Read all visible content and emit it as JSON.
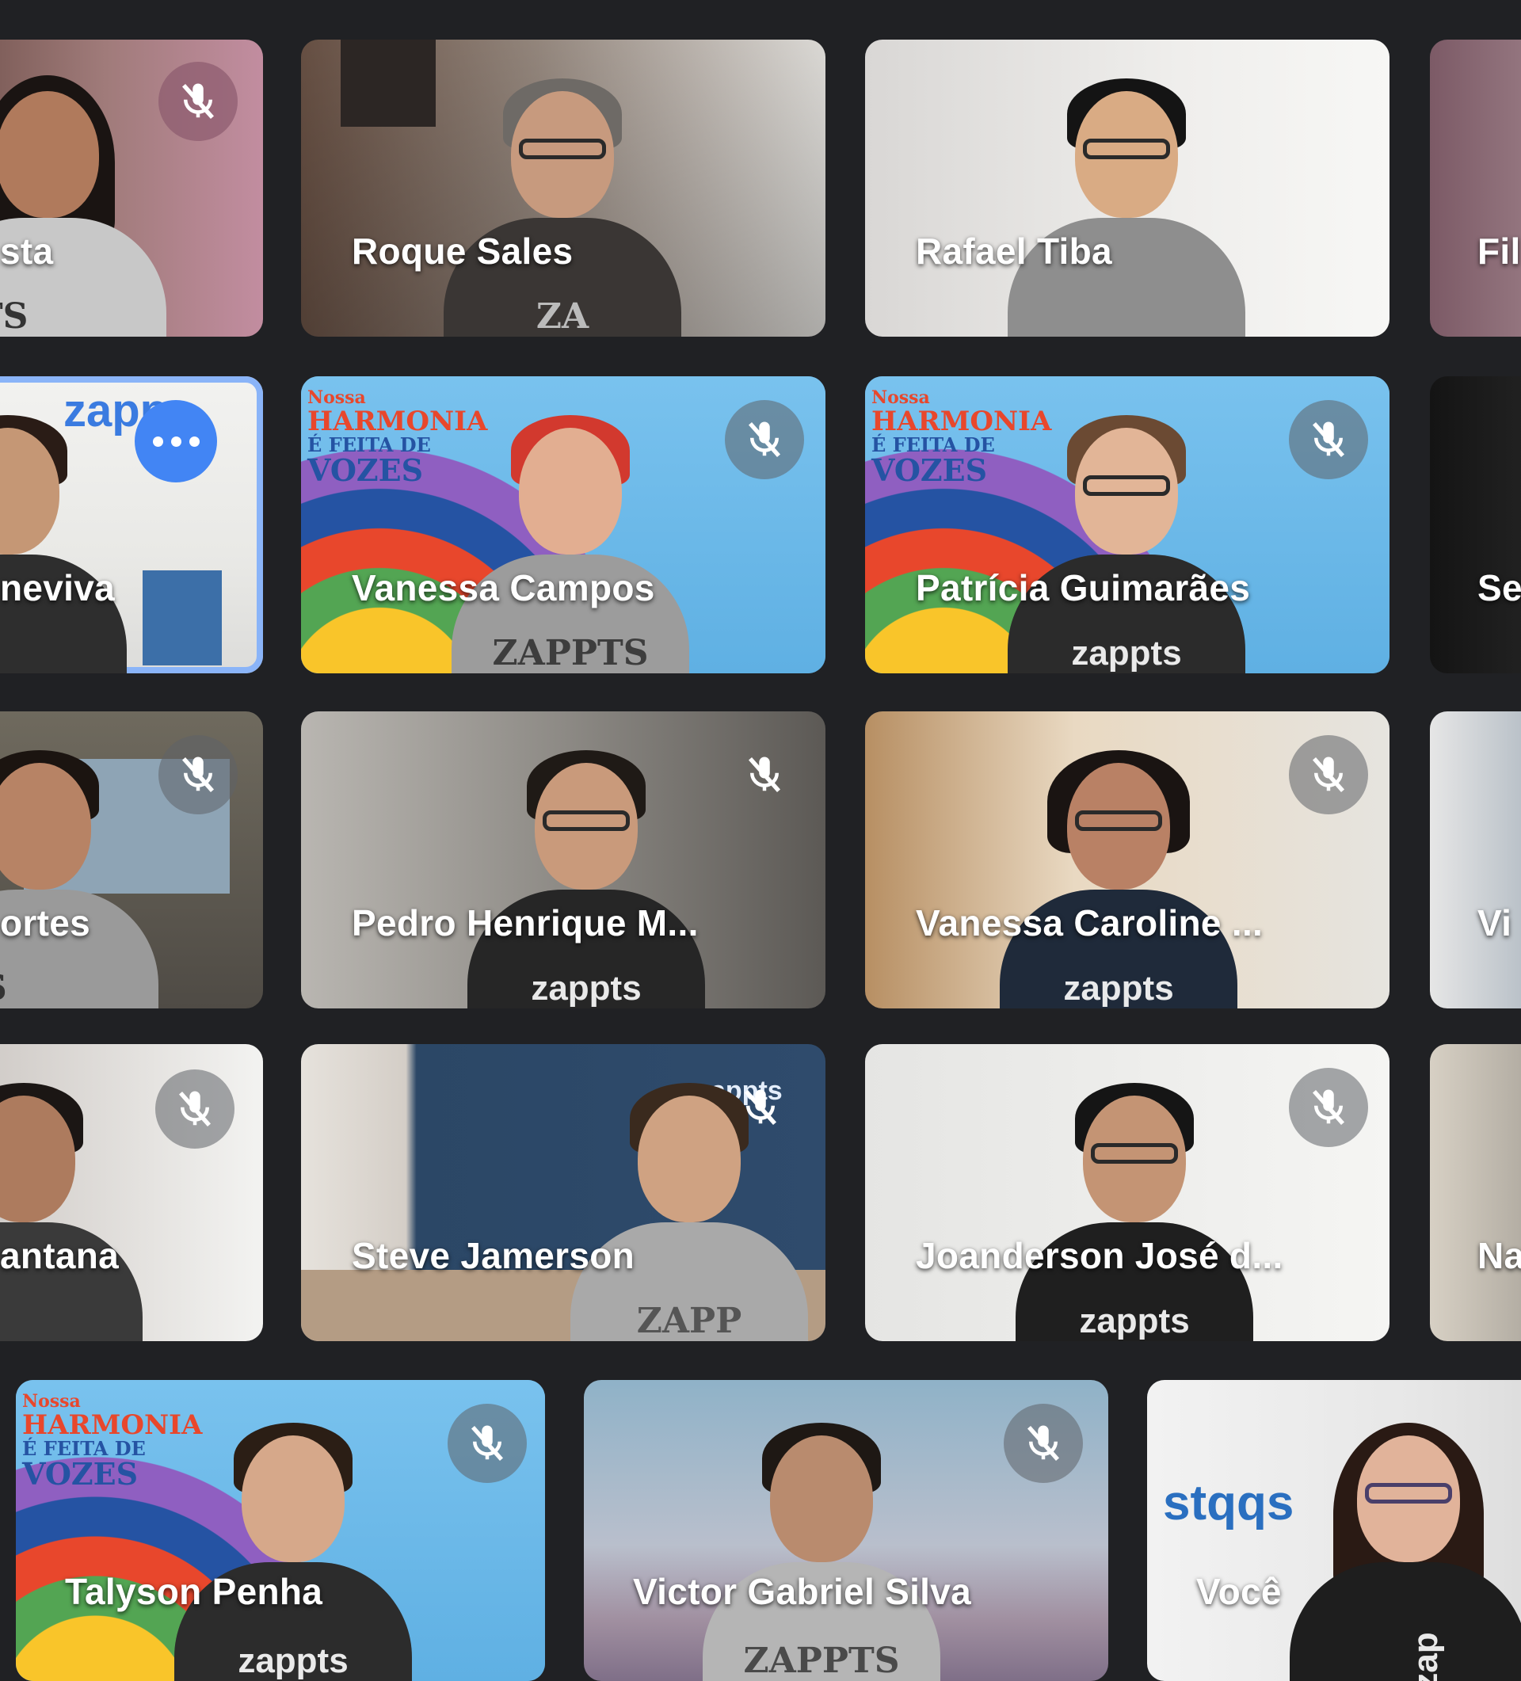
{
  "participants": [
    {
      "name": "sta",
      "muted": true,
      "state": "partial"
    },
    {
      "name": "Roque Sales",
      "muted": false
    },
    {
      "name": "Rafael Tiba",
      "muted": false
    },
    {
      "name": "Fil",
      "muted": false,
      "state": "partial"
    },
    {
      "name": "neviva",
      "muted": false,
      "active": true,
      "state": "partial"
    },
    {
      "name": "Vanessa Campos",
      "muted": true
    },
    {
      "name": "Patrícia Guimarães",
      "muted": true
    },
    {
      "name": "Se",
      "muted": false,
      "state": "partial"
    },
    {
      "name": "ortes",
      "muted": true,
      "state": "partial"
    },
    {
      "name": "Pedro Henrique M...",
      "muted": true
    },
    {
      "name": "Vanessa Caroline ...",
      "muted": true
    },
    {
      "name": "Vi",
      "muted": false,
      "state": "partial"
    },
    {
      "name": "antana",
      "muted": true,
      "state": "partial"
    },
    {
      "name": "Steve Jamerson",
      "muted": true
    },
    {
      "name": "Joanderson José d...",
      "muted": true
    },
    {
      "name": "Na",
      "muted": false,
      "state": "partial"
    },
    {
      "name": "Talyson Penha",
      "muted": true
    },
    {
      "name": "Victor Gabriel Silva",
      "muted": true
    },
    {
      "name": "Você",
      "muted": false
    }
  ],
  "shirt_text": {
    "zappts_caps": "ZAPPTS",
    "zappts_lower": "zappts",
    "zappts_caps_short": "PPTS",
    "zappts_caps_partial": "ZAPP",
    "zappts_caps_fragment": "PTS",
    "zappts_lower_partial": "zapp",
    "zappts_caps_letters": "ZA",
    "zappts_lower_short": "zap",
    "zappts_mirrored": "stqqs",
    "zappts_rotated": "zap"
  },
  "background_art": {
    "line1": "Nossa",
    "line2": "HARMONIA",
    "line3": "É FEITA DE",
    "line4": "VOZES"
  },
  "colors": {
    "background": "#202124",
    "active_outline": "#8ab4f8",
    "more_button": "#4285f4",
    "name_text": "#ffffff"
  },
  "icons": {
    "mute": "mic-off-icon",
    "more": "more-options-icon"
  }
}
